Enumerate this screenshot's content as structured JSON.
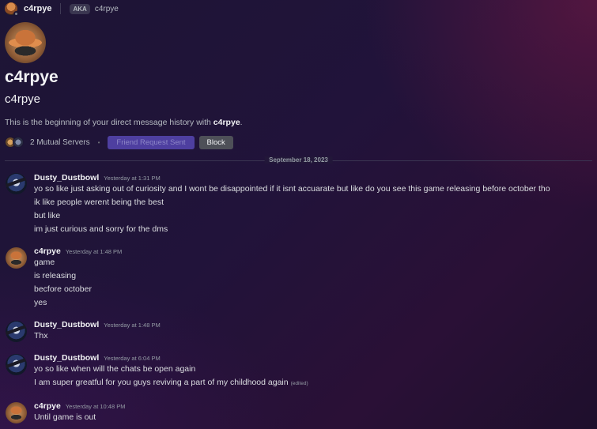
{
  "header": {
    "username": "c4rpye",
    "aka_label": "AKA",
    "aka_name": "c4rpye"
  },
  "profile": {
    "display_name": "c4rpye",
    "username": "c4rpye",
    "intro_prefix": "This is the beginning of your direct message history with ",
    "intro_name": "c4rpye",
    "intro_suffix": ".",
    "mutual_servers": "2 Mutual Servers",
    "bullet": "•",
    "friend_request_button": "Friend Request Sent",
    "block_button": "Block"
  },
  "date_divider": "September 18, 2023",
  "messages": [
    {
      "author": "Dusty_Dustbowl",
      "avatar": "dusty-avatar",
      "time": "Yesterday at 1:31 PM",
      "lines": [
        "yo so like just asking out of curiosity and I wont be disappointed if it isnt accuarate but like do you see this game releasing before october tho",
        "ik like people werent being the best",
        "but like",
        "im just curious and sorry for the dms"
      ]
    },
    {
      "author": "c4rpye",
      "avatar": "c4rpye-avatar",
      "time": "Yesterday at 1:48 PM",
      "lines": [
        "game",
        "is releasing",
        "becfore october",
        "yes"
      ]
    },
    {
      "author": "Dusty_Dustbowl",
      "avatar": "dusty-avatar",
      "time": "Yesterday at 1:48 PM",
      "lines": [
        "Thx"
      ]
    },
    {
      "author": "Dusty_Dustbowl",
      "avatar": "dusty-avatar",
      "time": "Yesterday at 6:04 PM",
      "lines": [
        "yo so like when will the chats be open again",
        "I am super greatful for you guys reviving a part of my childhood again"
      ],
      "edited_label": "(edited)"
    },
    {
      "author": "c4rpye",
      "avatar": "c4rpye-avatar",
      "time": "Yesterday at 10:48 PM",
      "lines": [
        "Until game is out"
      ]
    }
  ],
  "colors": {
    "friend_request_bg": "#4e3fa0",
    "block_bg": "#4e5058",
    "background": "#1d1535"
  }
}
